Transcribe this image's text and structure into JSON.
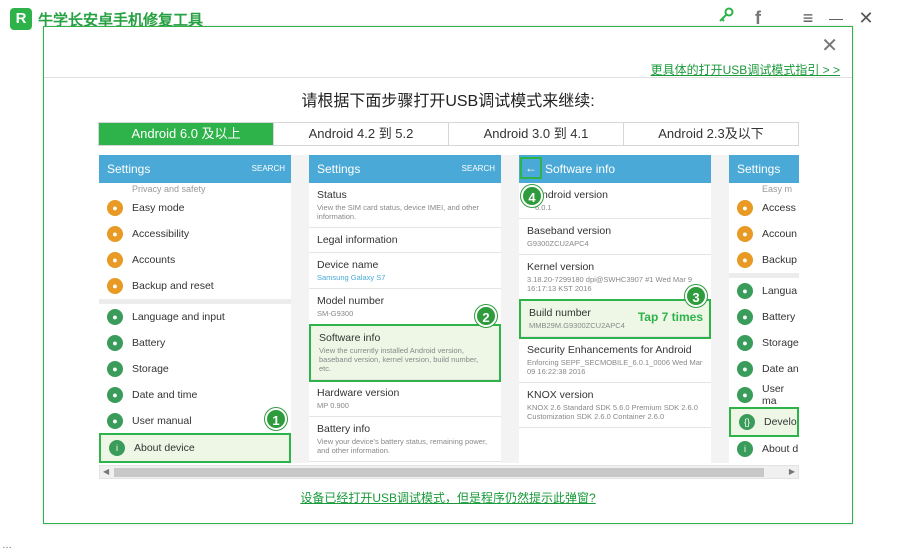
{
  "app": {
    "logo_letter": "R",
    "title": "牛学长安卓手机修复工具"
  },
  "titlebar": {
    "key_icon": "key-icon",
    "facebook": "f",
    "menu": "≡",
    "minimize": "—",
    "close": "✕"
  },
  "background": {
    "partial_text": "…"
  },
  "dialog": {
    "close": "✕",
    "more_link": "更具体的打开USB调试模式指引 > >",
    "heading": "请根据下面步骤打开USB调试模式来继续:",
    "tabs": [
      "Android 6.0 及以上",
      "Android 4.2 到 5.2",
      "Android 3.0 到 4.1",
      "Android 2.3及以下"
    ],
    "bottom_link": "设备已经打开USB调试模式，但是程序仍然提示此弹窗?"
  },
  "screen1": {
    "header": "Settings",
    "search": "SEARCH",
    "top_partial": "Privacy and safety",
    "items": [
      "Easy mode",
      "Accessibility",
      "Accounts",
      "Backup and reset"
    ],
    "items2": [
      "Language and input",
      "Battery",
      "Storage",
      "Date and time",
      "User manual",
      "About device"
    ],
    "badge": "1"
  },
  "screen2": {
    "header": "Settings",
    "search": "SEARCH",
    "items": [
      {
        "t": "Status",
        "d": "View the SIM card status, device IMEI, and other information."
      },
      {
        "t": "Legal information",
        "d": ""
      },
      {
        "t": "Device name",
        "d": "Samsung Galaxy S7"
      },
      {
        "t": "Model number",
        "d": "SM-G9300"
      },
      {
        "t": "Software info",
        "d": "View the currently installed Android version, baseband version, kernel version, build number, etc."
      },
      {
        "t": "Hardware version",
        "d": "MP 0.900"
      },
      {
        "t": "Battery info",
        "d": "View your device's battery status, remaining power, and other information."
      }
    ],
    "badge": "2"
  },
  "screen3": {
    "header": "Software info",
    "back": "←",
    "items": [
      {
        "t": "Android version",
        "d": "6.0.1"
      },
      {
        "t": "Baseband version",
        "d": "G9300ZCU2APC4"
      },
      {
        "t": "Kernel version",
        "d": "3.18.20-7299180 dpi@SWHC3907 #1 Wed Mar 9 16:17:13 KST 2016"
      },
      {
        "t": "Build number",
        "d": "MMB29M.G9300ZCU2APC4"
      },
      {
        "t": "Security Enhancements for Android",
        "d": "Enforcing SEPF_SECMOBILE_6.0.1_0006 Wed Mar 09 16:22:38 2016"
      },
      {
        "t": "KNOX version",
        "d": "KNOX 2.6 Standard SDK 5.6.0 Premium SDK 2.6.0 Customization SDK 2.6.0 Container 2.6.0"
      }
    ],
    "tap": "Tap 7 times",
    "badge3": "3",
    "badge4": "4"
  },
  "screen4": {
    "header": "Settings",
    "top_partial": "Easy m",
    "items": [
      "Access",
      "Accoun",
      "Backup"
    ],
    "items2": [
      "Langua",
      "Battery",
      "Storage",
      "Date an",
      "User ma",
      "Develop",
      "About d"
    ]
  }
}
